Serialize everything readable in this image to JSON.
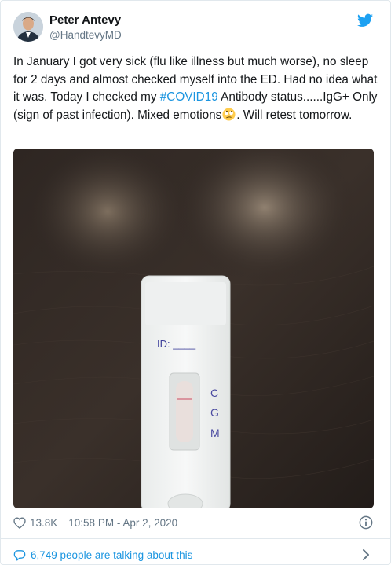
{
  "author": {
    "name": "Peter Antevy",
    "handle": "@HandtevyMD"
  },
  "tweet": {
    "text_before_hashtag": "In January I got very sick (flu like illness but much worse), no sleep for 2 days and almost checked myself into the ED.  Had no idea what it was.  Today I checked my ",
    "hashtag": "#COVID19",
    "text_after_hashtag": " Antibody status......IgG+ Only (sign of past infection).  Mixed emotions",
    "emoji": "face-with-rolling-eyes",
    "text_end": ". Will retest tomorrow."
  },
  "photo": {
    "id_label": "ID: ____",
    "marks": [
      "C",
      "G",
      "M"
    ]
  },
  "footer": {
    "likes": "13.8K",
    "timestamp": "10:58 PM - Apr 2, 2020"
  },
  "conversation": {
    "label": "6,749 people are talking about this"
  },
  "colors": {
    "link": "#1b95e0",
    "text": "#14171a",
    "muted": "#657786",
    "border": "#e1e8ed"
  }
}
